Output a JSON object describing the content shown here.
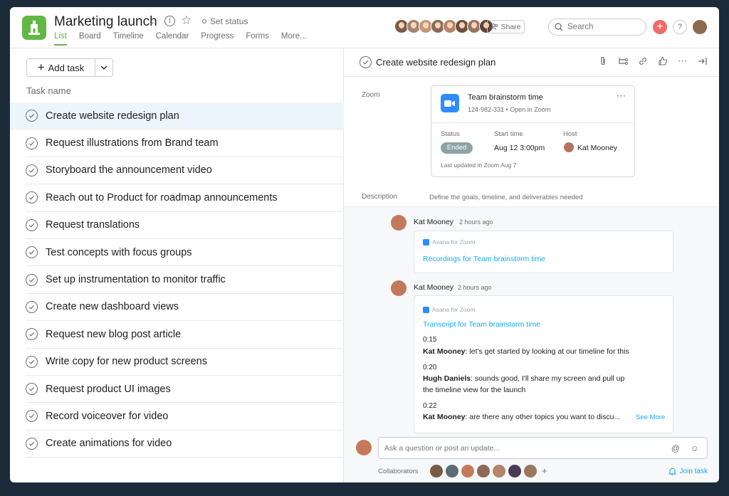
{
  "header": {
    "project_title": "Marketing launch",
    "set_status": "Set status",
    "tabs": [
      {
        "label": "List"
      },
      {
        "label": "Board"
      },
      {
        "label": "Timeline"
      },
      {
        "label": "Calendar"
      },
      {
        "label": "Progress"
      },
      {
        "label": "Forms"
      },
      {
        "label": "More..."
      }
    ],
    "share_label": "Share",
    "search_placeholder": "Search",
    "member_colors": [
      "#7a5a45",
      "#a8836b",
      "#c99679",
      "#8e6a56",
      "#b58469",
      "#6f4e3d",
      "#9a7560",
      "#5b4437"
    ]
  },
  "list": {
    "add_task_label": "Add task",
    "column_header": "Task name",
    "tasks": [
      {
        "name": "Create website redesign plan"
      },
      {
        "name": "Request illustrations from Brand team"
      },
      {
        "name": "Storyboard the announcement video"
      },
      {
        "name": "Reach out to Product for roadmap announcements"
      },
      {
        "name": "Request translations"
      },
      {
        "name": "Test concepts with focus groups"
      },
      {
        "name": "Set up instrumentation to monitor traffic"
      },
      {
        "name": "Create new dashboard views"
      },
      {
        "name": "Request new blog post article"
      },
      {
        "name": "Write copy for new product screens"
      },
      {
        "name": "Request product UI images"
      },
      {
        "name": "Record voiceover for video"
      },
      {
        "name": "Create animations for video"
      }
    ]
  },
  "detail": {
    "title": "Create website redesign plan",
    "zoom_label": "Zoom",
    "zoom_card": {
      "title": "Team brainstorm time",
      "subtitle": "124-982-331 • Open in Zoom",
      "status_label": "Status",
      "status_value": "Ended",
      "start_label": "Start time",
      "start_value": "Aug 12 3:00pm",
      "host_label": "Host",
      "host_value": "Kat Mooney",
      "updated": "Last updated in Zoom Aug 7"
    },
    "description_label": "Description",
    "description": "Define the goals, timeline, and deliverables needed"
  },
  "activity": {
    "stories": [
      {
        "author": "Kat Mooney",
        "time": "2 hours ago",
        "source": "Asana for Zoom",
        "link": "Recordings for Team brainstorm time"
      },
      {
        "author": "Kat Mooney",
        "time": "2 hours ago",
        "source": "Asana for Zoom",
        "link": "Transcript for Team brainstorm time",
        "transcript": [
          {
            "ts": "0:15",
            "speaker": "Kat Mooney",
            "text": ": let's get started by looking at our timeline for this"
          },
          {
            "ts": "0:20",
            "speaker": "Hugh Daniels",
            "text": ": sounds good, I'll share my screen and pull up",
            "text2": "the timeline view for the launch"
          },
          {
            "ts": "0:22",
            "speaker": "Kat Mooney",
            "text": ": are there any other topics you want to discu..."
          }
        ],
        "see_more": "See More"
      }
    ]
  },
  "comment": {
    "placeholder": "Ask a question or post an update...",
    "collaborators_label": "Collaborators",
    "join_task": "Join task",
    "collaborator_colors": [
      "#7a5a45",
      "#5f6b73",
      "#c47a5a",
      "#8e6a56",
      "#b58469",
      "#4a3a55",
      "#9a7560"
    ]
  },
  "colors": {
    "accent_green": "#6ab04c",
    "link_blue": "#14aaf5",
    "zoom_blue": "#2d8cff",
    "add_red": "#f06a6a"
  }
}
